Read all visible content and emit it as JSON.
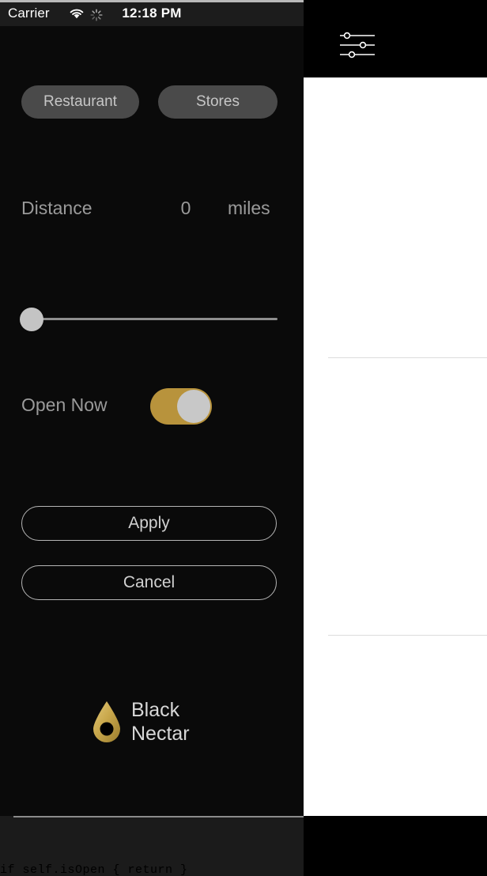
{
  "status_bar": {
    "carrier": "Carrier",
    "time": "12:18 PM",
    "wifi_icon": "wifi-icon",
    "activity_icon": "activity-spinner-icon",
    "battery_icon": "battery-charging-icon",
    "battery_color": "#4cd964"
  },
  "filters": {
    "categories": [
      {
        "label": "Restaurant",
        "selected": false
      },
      {
        "label": "Stores",
        "selected": false
      }
    ],
    "distance": {
      "label": "Distance",
      "value": "0",
      "unit": "miles",
      "slider_min": 0,
      "slider_max": 100,
      "slider_value": 0
    },
    "open_now": {
      "label": "Open Now",
      "enabled": true,
      "accent_color": "#b8933c"
    },
    "actions": {
      "apply_label": "Apply",
      "cancel_label": "Cancel"
    }
  },
  "brand": {
    "name": "Black\nNectar",
    "logo_icon": "nectar-drop-icon",
    "logo_color": "#c9a84c"
  },
  "right_pane": {
    "filter_icon": "sliders-filter-icon",
    "sheet_background": "#ffffff",
    "separator_color": "#dcdcdc"
  },
  "bottom_editor": {
    "code_fragment": "if self.isOpen { return }"
  }
}
